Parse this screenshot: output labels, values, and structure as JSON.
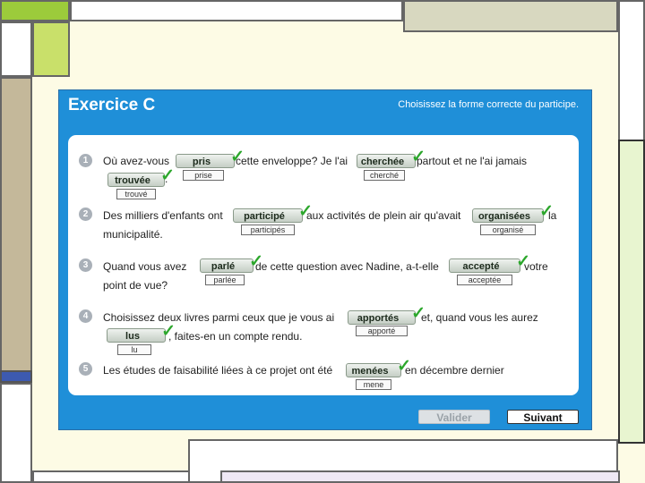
{
  "exercise": {
    "title": "Exercice C",
    "instruction": "Choisissez la forme correcte du participe."
  },
  "questions": [
    {
      "number": "1",
      "segments": [
        "Où avez-vous",
        "cette enveloppe? Je l'ai",
        "partout et ne l'ai jamais",
        "."
      ],
      "answers": [
        {
          "selected": "pris",
          "correct": "prise"
        },
        {
          "selected": "cherchée",
          "correct": "cherché"
        },
        {
          "selected": "trouvée",
          "correct": "trouvé"
        }
      ]
    },
    {
      "number": "2",
      "segments": [
        "Des milliers d'enfants ont",
        "aux activités de plein air qu'avait",
        "la",
        "municipalité."
      ],
      "answers": [
        {
          "selected": "participé",
          "correct": "participés"
        },
        {
          "selected": "organisées",
          "correct": "organisé"
        }
      ]
    },
    {
      "number": "3",
      "segments": [
        "Quand vous avez",
        "de cette question avec Nadine, a-t-elle",
        "votre",
        "point de vue?"
      ],
      "answers": [
        {
          "selected": "parlé",
          "correct": "parlée"
        },
        {
          "selected": "accepté",
          "correct": "acceptée"
        }
      ]
    },
    {
      "number": "4",
      "segments": [
        "Choisissez deux livres parmi ceux que je vous ai",
        "et, quand vous les aurez",
        ", faites-en un compte rendu."
      ],
      "answers": [
        {
          "selected": "apportés",
          "correct": "apporté"
        },
        {
          "selected": "lus",
          "correct": "lu"
        }
      ]
    },
    {
      "number": "5",
      "segments": [
        "Les études de faisabilité liées à ce projet ont été",
        "en décembre dernier"
      ],
      "answers": [
        {
          "selected": "menées",
          "correct": "mene"
        }
      ]
    }
  ],
  "checkmark": "✓",
  "buttons": {
    "validate": "Valider",
    "next": "Suivant"
  },
  "colors": {
    "window_blue": "#1f8fd8",
    "check_green": "#2ca72c",
    "slide_accent_green": "#c9e06a"
  }
}
